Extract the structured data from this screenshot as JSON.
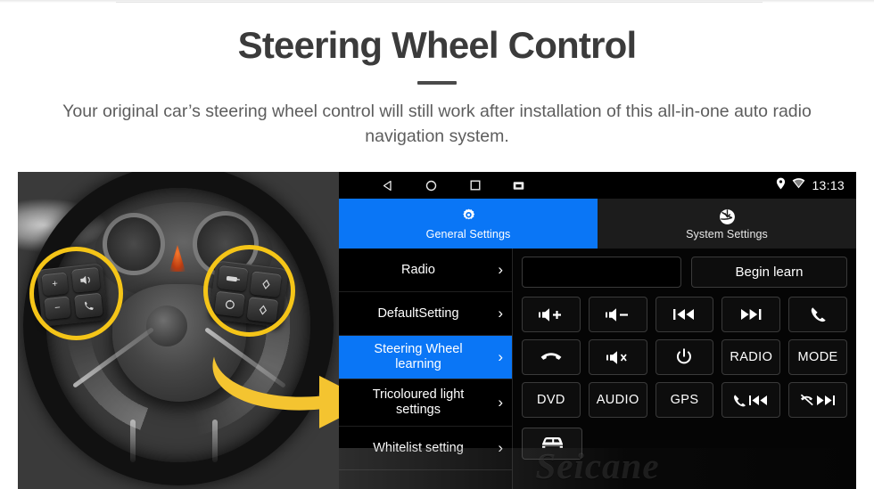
{
  "header": {
    "title": "Steering Wheel Control",
    "subtitle": "Your original car’s steering wheel control will still work after installation of this all-in-one auto radio navigation system."
  },
  "photo": {
    "alt_name": "steering-wheel-photo",
    "highlight_color": "#F5C518",
    "arrow_color": "#F4C430"
  },
  "device": {
    "statusbar": {
      "nav_icons": [
        "back-icon",
        "home-icon",
        "recents-icon",
        "screenshot-icon"
      ],
      "status_icons": [
        "location-pin-icon",
        "wifi-icon"
      ],
      "clock": "13:13"
    },
    "tabs": [
      {
        "label": "General Settings",
        "icon": "gear-icon",
        "active": true
      },
      {
        "label": "System Settings",
        "icon": "system-logo-icon",
        "active": false
      }
    ],
    "menu": [
      {
        "label": "Radio",
        "active": false
      },
      {
        "label": "DefaultSetting",
        "active": false
      },
      {
        "label": "Steering Wheel learning",
        "active": true
      },
      {
        "label": "Tricoloured light settings",
        "active": false
      },
      {
        "label": "Whitelist setting",
        "active": false
      }
    ],
    "panel": {
      "input_value": "",
      "input_placeholder": "",
      "begin_learn_label": "Begin learn",
      "buttons": [
        {
          "label": "",
          "icon": "volume-up-icon"
        },
        {
          "label": "",
          "icon": "volume-down-icon"
        },
        {
          "label": "",
          "icon": "previous-track-icon"
        },
        {
          "label": "",
          "icon": "next-track-icon"
        },
        {
          "label": "",
          "icon": "answer-call-icon"
        },
        {
          "label": "",
          "icon": "hang-up-icon"
        },
        {
          "label": "",
          "icon": "mute-icon"
        },
        {
          "label": "",
          "icon": "power-icon"
        },
        {
          "label": "RADIO",
          "icon": ""
        },
        {
          "label": "MODE",
          "icon": ""
        },
        {
          "label": "DVD",
          "icon": ""
        },
        {
          "label": "AUDIO",
          "icon": ""
        },
        {
          "label": "GPS",
          "icon": ""
        },
        {
          "label": "",
          "icon": "call-previous-icon"
        },
        {
          "label": "",
          "icon": "hangup-next-icon"
        }
      ],
      "car_button_icon": "car-icon"
    },
    "watermark": "Seicane",
    "accent_color": "#0a76F6"
  }
}
